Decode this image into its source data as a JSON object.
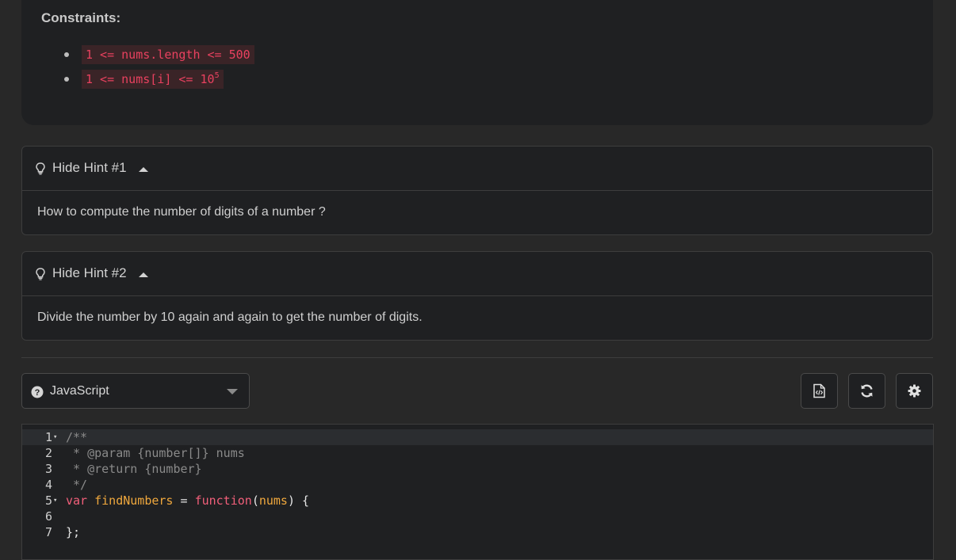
{
  "constraints": {
    "title": "Constraints:",
    "items": [
      {
        "text": "1 <= nums.length <= 500",
        "sup": ""
      },
      {
        "text": "1 <= nums[i] <= 10",
        "sup": "5"
      }
    ]
  },
  "hints": [
    {
      "label": "Hide Hint #1",
      "text": "How to compute the number of digits of a number ?"
    },
    {
      "label": "Hide Hint #2",
      "text": "Divide the number by 10 again and again to get the number of digits."
    }
  ],
  "editor": {
    "language": "JavaScript",
    "lines": [
      {
        "num": "1",
        "fold": "▾",
        "comment": "/**"
      },
      {
        "num": "2",
        "fold": "",
        "comment": " * @param {number[]} nums"
      },
      {
        "num": "3",
        "fold": "",
        "comment": " * @return {number}"
      },
      {
        "num": "4",
        "fold": "",
        "comment": " */"
      },
      {
        "num": "5",
        "fold": "▾",
        "kw1": "var",
        "fn": "findNumbers",
        "eq": " = ",
        "kw2": "function",
        "open": "(",
        "param": "nums",
        "close": ") {"
      },
      {
        "num": "6",
        "fold": "",
        "comment": ""
      },
      {
        "num": "7",
        "fold": "",
        "plain": "};"
      }
    ]
  },
  "icons": {
    "hint": "lightbulb-icon",
    "language": "question-circle-icon",
    "toolbar": [
      "file-code-icon",
      "refresh-icon",
      "gear-icon"
    ]
  }
}
